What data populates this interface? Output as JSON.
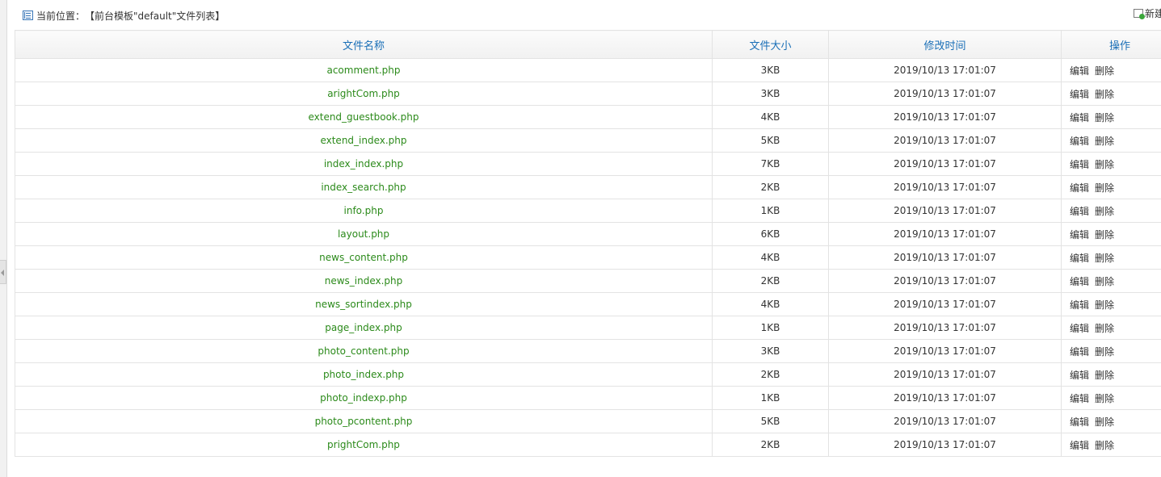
{
  "breadcrumb": {
    "icon": "document-list-icon",
    "label": "当前位置：",
    "path": "【前台模板\"default\"文件列表】"
  },
  "toolbar": {
    "new_label": "新建",
    "new_icon": "new-file-icon"
  },
  "table": {
    "headers": [
      "文件名称",
      "文件大小",
      "修改时间",
      "操作"
    ],
    "edit_label": "编辑",
    "delete_label": "删除",
    "rows": [
      {
        "name": "acomment.php",
        "size": "3KB",
        "modified": "2019/10/13 17:01:07"
      },
      {
        "name": "arightCom.php",
        "size": "3KB",
        "modified": "2019/10/13 17:01:07"
      },
      {
        "name": "extend_guestbook.php",
        "size": "4KB",
        "modified": "2019/10/13 17:01:07"
      },
      {
        "name": "extend_index.php",
        "size": "5KB",
        "modified": "2019/10/13 17:01:07"
      },
      {
        "name": "index_index.php",
        "size": "7KB",
        "modified": "2019/10/13 17:01:07"
      },
      {
        "name": "index_search.php",
        "size": "2KB",
        "modified": "2019/10/13 17:01:07"
      },
      {
        "name": "info.php",
        "size": "1KB",
        "modified": "2019/10/13 17:01:07"
      },
      {
        "name": "layout.php",
        "size": "6KB",
        "modified": "2019/10/13 17:01:07"
      },
      {
        "name": "news_content.php",
        "size": "4KB",
        "modified": "2019/10/13 17:01:07"
      },
      {
        "name": "news_index.php",
        "size": "2KB",
        "modified": "2019/10/13 17:01:07"
      },
      {
        "name": "news_sortindex.php",
        "size": "4KB",
        "modified": "2019/10/13 17:01:07"
      },
      {
        "name": "page_index.php",
        "size": "1KB",
        "modified": "2019/10/13 17:01:07"
      },
      {
        "name": "photo_content.php",
        "size": "3KB",
        "modified": "2019/10/13 17:01:07"
      },
      {
        "name": "photo_index.php",
        "size": "2KB",
        "modified": "2019/10/13 17:01:07"
      },
      {
        "name": "photo_indexp.php",
        "size": "1KB",
        "modified": "2019/10/13 17:01:07"
      },
      {
        "name": "photo_pcontent.php",
        "size": "5KB",
        "modified": "2019/10/13 17:01:07"
      },
      {
        "name": "prightCom.php",
        "size": "2KB",
        "modified": "2019/10/13 17:01:07"
      }
    ]
  },
  "colors": {
    "header_text": "#1a6fb7",
    "file_name_text": "#2b8a1a",
    "border": "#e3e3e3"
  }
}
